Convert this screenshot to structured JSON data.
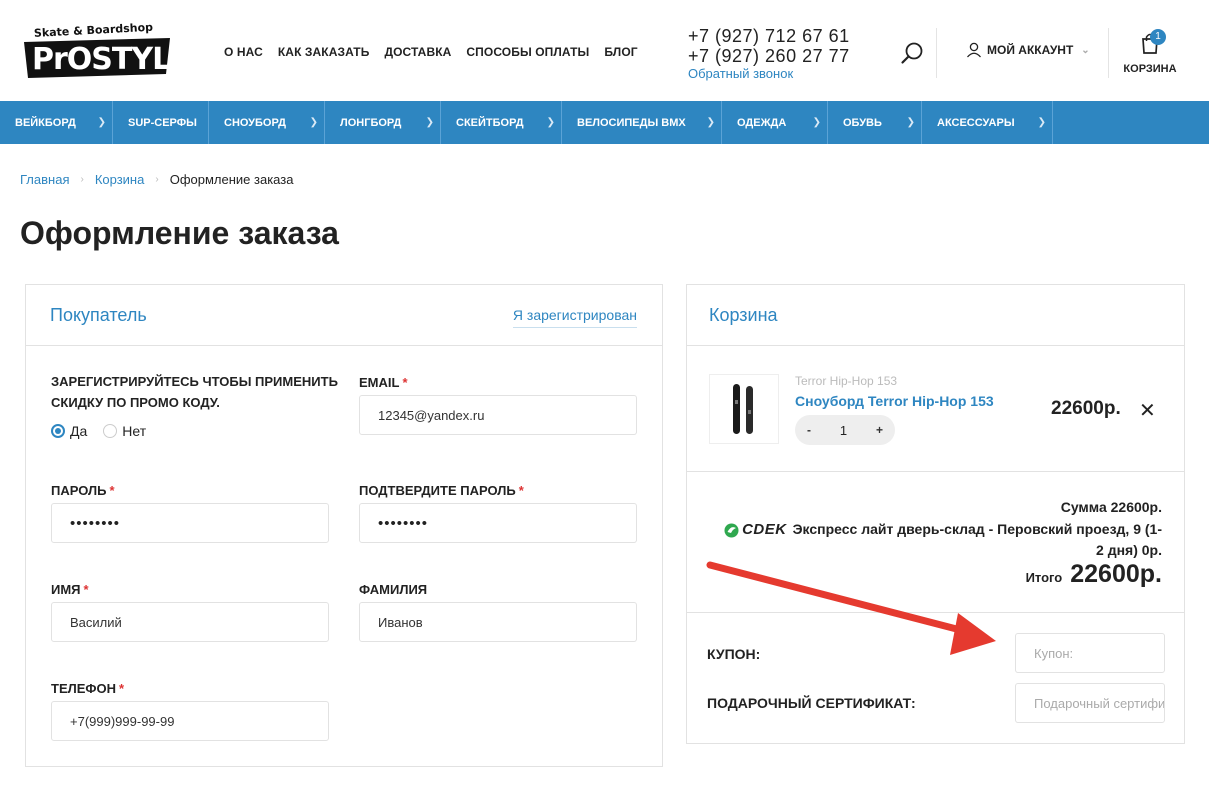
{
  "header": {
    "logo_text": "Skate & Boardshop PROSTYLE",
    "nav": [
      "О НАС",
      "КАК ЗАКАЗАТЬ",
      "ДОСТАВКА",
      "СПОСОБЫ ОПЛАТЫ",
      "БЛОГ"
    ],
    "phones": [
      "+7 (927) 712 67 61",
      "+7 (927) 260 27 77"
    ],
    "callback": "Обратный звонок",
    "search_icon": "search-icon",
    "account_label": "МОЙ АККАУНТ",
    "cart_label": "КОРЗИНА",
    "cart_count": "1"
  },
  "categories": [
    "ВЕЙКБОРД",
    "SUP-СЕРФЫ",
    "СНОУБОРД",
    "ЛОНГБОРД",
    "СКЕЙТБОРД",
    "ВЕЛОСИПЕДЫ BMX",
    "ОДЕЖДА",
    "ОБУВЬ",
    "АКСЕССУАРЫ"
  ],
  "breadcrumb": {
    "home": "Главная",
    "cart": "Корзина",
    "current": "Оформление заказа"
  },
  "page_title": "Оформление заказа",
  "buyer": {
    "title": "Покупатель",
    "registered_link": "Я зарегистрирован",
    "promo_text": "ЗАРЕГИСТРИРУЙТЕСЬ ЧТОБЫ ПРИМЕНИТЬ СКИДКУ ПО ПРОМО КОДУ.",
    "radio_yes": "Да",
    "radio_no": "Нет",
    "email_label": "EMAIL",
    "email_value": "12345@yandex.ru",
    "password_label": "ПАРОЛЬ",
    "password_value": "••••••••",
    "confirm_label": "ПОДТВЕРДИТЕ ПАРОЛЬ",
    "confirm_value": "••••••••",
    "name_label": "ИМЯ",
    "name_value": "Василий",
    "surname_label": "ФАМИЛИЯ",
    "surname_value": "Иванов",
    "phone_label": "ТЕЛЕФОН",
    "phone_value": "+7(999)999-99-99",
    "required_mark": "*"
  },
  "basket": {
    "title": "Корзина",
    "item": {
      "brand": "Terror Hip-Hop 153",
      "name": "Сноуборд Terror Hip-Hop 153",
      "qty_minus": "-",
      "qty": "1",
      "qty_plus": "+",
      "price": "22600р.",
      "remove": "✕"
    },
    "sum": "Сумма 22600р.",
    "cdek_logo": "CDEK",
    "delivery": "Экспресс лайт дверь-склад - Перовский проезд, 9 (1-2 дня) 0р.",
    "total_label": "Итого",
    "total_value": "22600р.",
    "coupon_label": "КУПОН:",
    "coupon_placeholder": "Купон:",
    "gift_label": "ПОДАРОЧНЫЙ СЕРТИФИКАТ:",
    "gift_placeholder": "Подарочный сертификат"
  },
  "colors": {
    "accent": "#2e86c1",
    "required": "#dd3333",
    "arrow": "#e53a2f"
  }
}
